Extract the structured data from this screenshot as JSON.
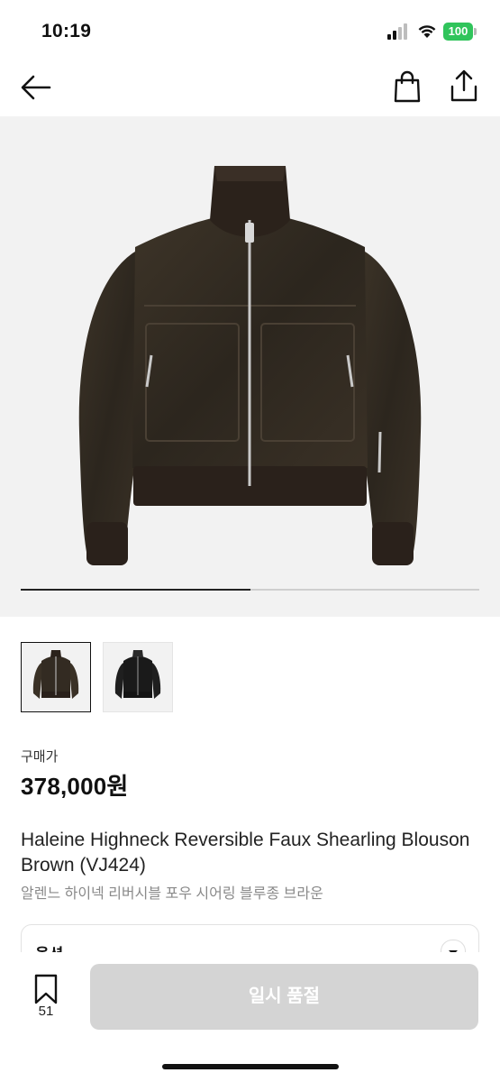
{
  "status": {
    "time": "10:19",
    "battery": "100"
  },
  "nav": {
    "back_icon": "back-arrow-icon",
    "bag_icon": "shopping-bag-icon",
    "share_icon": "share-icon"
  },
  "gallery": {
    "progress": 0.5,
    "thumbnails": [
      "brown-jacket",
      "black-jacket"
    ],
    "selected": 0
  },
  "product": {
    "price_label": "구매가",
    "price": "378,000원",
    "title": "Haleine Highneck Reversible Faux Shearling Blouson Brown (VJ424)",
    "subtitle": "알렌느 하이넥 리버시블 포우 시어링 블루종 브라운"
  },
  "option": {
    "label": "옵션"
  },
  "bottom": {
    "bookmark_count": "51",
    "soldout_label": "일시 품절"
  },
  "colors": {
    "accent": "#111111",
    "disabled": "#d4d4d4",
    "battery": "#30c45b"
  }
}
